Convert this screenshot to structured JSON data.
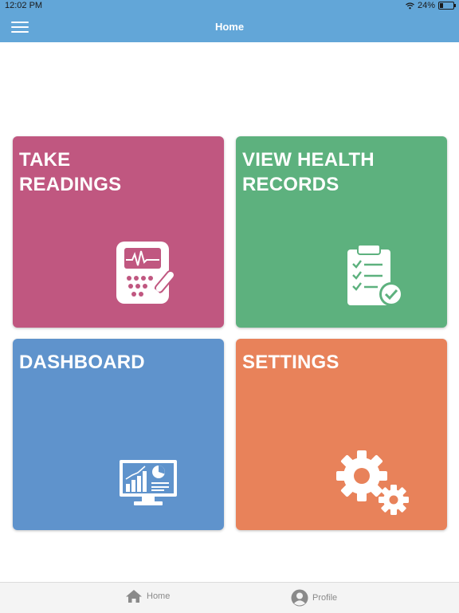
{
  "status_bar": {
    "time": "12:02 PM",
    "battery": "24%",
    "battery_level": 0.24
  },
  "nav": {
    "title": "Home",
    "menu_icon": "hamburger-menu-icon"
  },
  "tiles": [
    {
      "label": "TAKE\nREADINGS",
      "color": "#c05780",
      "icon": "blood-pressure-monitor-icon"
    },
    {
      "label": "VIEW HEALTH\nRECORDS",
      "color": "#5db17e",
      "icon": "clipboard-checklist-icon"
    },
    {
      "label": "DASHBOARD",
      "color": "#5f93cc",
      "icon": "analytics-monitor-icon"
    },
    {
      "label": "SETTINGS",
      "color": "#e8825a",
      "icon": "gears-icon"
    }
  ],
  "tab_bar": {
    "home": {
      "label": "Home",
      "icon": "home-icon"
    },
    "profile": {
      "label": "Profile",
      "icon": "user-avatar-icon"
    }
  }
}
